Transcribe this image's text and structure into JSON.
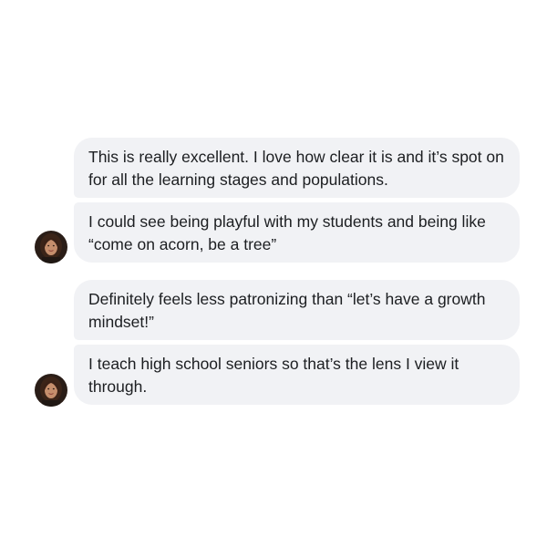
{
  "conversation": {
    "groups": [
      {
        "avatar": "user-avatar",
        "messages": [
          "This is really excellent. I love how clear it is and it’s spot on for all the learning stages and populations.",
          "I could see being playful with my students and being like “come on acorn, be a tree”"
        ]
      },
      {
        "avatar": "user-avatar",
        "messages": [
          "Definitely feels less patronizing than “let’s have a growth mindset!”",
          "I teach high school seniors so that’s the lens I view it through."
        ]
      }
    ]
  },
  "colors": {
    "bubble_background": "#f1f2f5",
    "text": "#1c1e21",
    "page_background": "#ffffff"
  }
}
